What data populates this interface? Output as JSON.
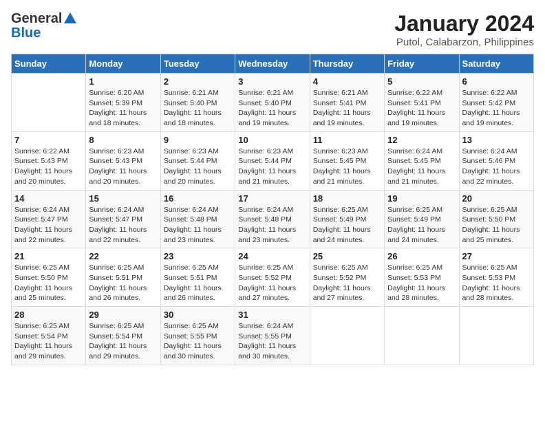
{
  "header": {
    "logo_general": "General",
    "logo_blue": "Blue",
    "month_year": "January 2024",
    "location": "Putol, Calabarzon, Philippines"
  },
  "days_of_week": [
    "Sunday",
    "Monday",
    "Tuesday",
    "Wednesday",
    "Thursday",
    "Friday",
    "Saturday"
  ],
  "weeks": [
    [
      {
        "day": "",
        "info": ""
      },
      {
        "day": "1",
        "info": "Sunrise: 6:20 AM\nSunset: 5:39 PM\nDaylight: 11 hours\nand 18 minutes."
      },
      {
        "day": "2",
        "info": "Sunrise: 6:21 AM\nSunset: 5:40 PM\nDaylight: 11 hours\nand 18 minutes."
      },
      {
        "day": "3",
        "info": "Sunrise: 6:21 AM\nSunset: 5:40 PM\nDaylight: 11 hours\nand 19 minutes."
      },
      {
        "day": "4",
        "info": "Sunrise: 6:21 AM\nSunset: 5:41 PM\nDaylight: 11 hours\nand 19 minutes."
      },
      {
        "day": "5",
        "info": "Sunrise: 6:22 AM\nSunset: 5:41 PM\nDaylight: 11 hours\nand 19 minutes."
      },
      {
        "day": "6",
        "info": "Sunrise: 6:22 AM\nSunset: 5:42 PM\nDaylight: 11 hours\nand 19 minutes."
      }
    ],
    [
      {
        "day": "7",
        "info": "Sunrise: 6:22 AM\nSunset: 5:43 PM\nDaylight: 11 hours\nand 20 minutes."
      },
      {
        "day": "8",
        "info": "Sunrise: 6:23 AM\nSunset: 5:43 PM\nDaylight: 11 hours\nand 20 minutes."
      },
      {
        "day": "9",
        "info": "Sunrise: 6:23 AM\nSunset: 5:44 PM\nDaylight: 11 hours\nand 20 minutes."
      },
      {
        "day": "10",
        "info": "Sunrise: 6:23 AM\nSunset: 5:44 PM\nDaylight: 11 hours\nand 21 minutes."
      },
      {
        "day": "11",
        "info": "Sunrise: 6:23 AM\nSunset: 5:45 PM\nDaylight: 11 hours\nand 21 minutes."
      },
      {
        "day": "12",
        "info": "Sunrise: 6:24 AM\nSunset: 5:45 PM\nDaylight: 11 hours\nand 21 minutes."
      },
      {
        "day": "13",
        "info": "Sunrise: 6:24 AM\nSunset: 5:46 PM\nDaylight: 11 hours\nand 22 minutes."
      }
    ],
    [
      {
        "day": "14",
        "info": "Sunrise: 6:24 AM\nSunset: 5:47 PM\nDaylight: 11 hours\nand 22 minutes."
      },
      {
        "day": "15",
        "info": "Sunrise: 6:24 AM\nSunset: 5:47 PM\nDaylight: 11 hours\nand 22 minutes."
      },
      {
        "day": "16",
        "info": "Sunrise: 6:24 AM\nSunset: 5:48 PM\nDaylight: 11 hours\nand 23 minutes."
      },
      {
        "day": "17",
        "info": "Sunrise: 6:24 AM\nSunset: 5:48 PM\nDaylight: 11 hours\nand 23 minutes."
      },
      {
        "day": "18",
        "info": "Sunrise: 6:25 AM\nSunset: 5:49 PM\nDaylight: 11 hours\nand 24 minutes."
      },
      {
        "day": "19",
        "info": "Sunrise: 6:25 AM\nSunset: 5:49 PM\nDaylight: 11 hours\nand 24 minutes."
      },
      {
        "day": "20",
        "info": "Sunrise: 6:25 AM\nSunset: 5:50 PM\nDaylight: 11 hours\nand 25 minutes."
      }
    ],
    [
      {
        "day": "21",
        "info": "Sunrise: 6:25 AM\nSunset: 5:50 PM\nDaylight: 11 hours\nand 25 minutes."
      },
      {
        "day": "22",
        "info": "Sunrise: 6:25 AM\nSunset: 5:51 PM\nDaylight: 11 hours\nand 26 minutes."
      },
      {
        "day": "23",
        "info": "Sunrise: 6:25 AM\nSunset: 5:51 PM\nDaylight: 11 hours\nand 26 minutes."
      },
      {
        "day": "24",
        "info": "Sunrise: 6:25 AM\nSunset: 5:52 PM\nDaylight: 11 hours\nand 27 minutes."
      },
      {
        "day": "25",
        "info": "Sunrise: 6:25 AM\nSunset: 5:52 PM\nDaylight: 11 hours\nand 27 minutes."
      },
      {
        "day": "26",
        "info": "Sunrise: 6:25 AM\nSunset: 5:53 PM\nDaylight: 11 hours\nand 28 minutes."
      },
      {
        "day": "27",
        "info": "Sunrise: 6:25 AM\nSunset: 5:53 PM\nDaylight: 11 hours\nand 28 minutes."
      }
    ],
    [
      {
        "day": "28",
        "info": "Sunrise: 6:25 AM\nSunset: 5:54 PM\nDaylight: 11 hours\nand 29 minutes."
      },
      {
        "day": "29",
        "info": "Sunrise: 6:25 AM\nSunset: 5:54 PM\nDaylight: 11 hours\nand 29 minutes."
      },
      {
        "day": "30",
        "info": "Sunrise: 6:25 AM\nSunset: 5:55 PM\nDaylight: 11 hours\nand 30 minutes."
      },
      {
        "day": "31",
        "info": "Sunrise: 6:24 AM\nSunset: 5:55 PM\nDaylight: 11 hours\nand 30 minutes."
      },
      {
        "day": "",
        "info": ""
      },
      {
        "day": "",
        "info": ""
      },
      {
        "day": "",
        "info": ""
      }
    ]
  ]
}
